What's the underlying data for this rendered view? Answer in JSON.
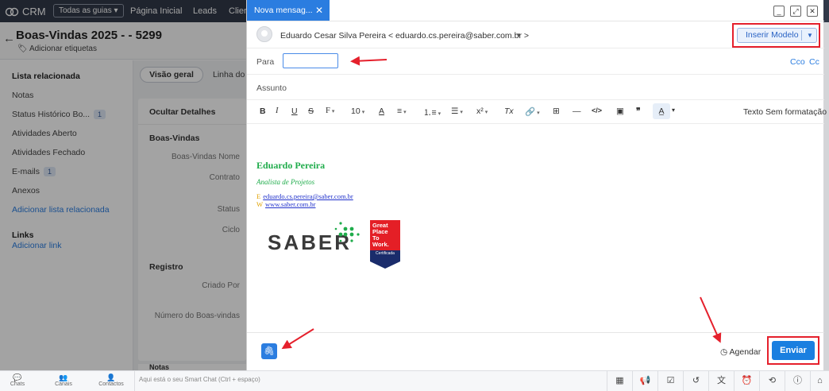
{
  "topnav": {
    "logo": "CRM",
    "all_tabs": "Todas as guias",
    "links": [
      "Página Inicial",
      "Leads",
      "Clier"
    ]
  },
  "record": {
    "title": "Boas-Vindas 2025 - - 5299",
    "add_tags": "Adicionar etiquetas"
  },
  "sidebar": {
    "section_related": "Lista relacionada",
    "items": [
      {
        "label": "Notas",
        "badge": ""
      },
      {
        "label": "Status Histórico Bo...",
        "badge": "1"
      },
      {
        "label": "Atividades Aberto",
        "badge": ""
      },
      {
        "label": "Atividades Fechado",
        "badge": ""
      },
      {
        "label": "E-mails",
        "badge": "1"
      },
      {
        "label": "Anexos",
        "badge": ""
      }
    ],
    "add_related": "Adicionar lista relacionada",
    "links_title": "Links",
    "add_link": "Adicionar link"
  },
  "detail": {
    "tab_overview": "Visão geral",
    "tab_timeline": "Linha do",
    "hide_details": "Ocultar Detalhes",
    "section1": "Boas-Vindas",
    "fields1": [
      "Boas-Vindas Nome",
      "Contrato",
      "Status",
      "Ciclo"
    ],
    "section2": "Registro",
    "fields2": [
      "Criado Por",
      "Número do Boas-vindas"
    ],
    "notes_partial": "Notas"
  },
  "compose": {
    "tab_title": "Nova mensag...",
    "from": "Eduardo Cesar Silva Pereira < eduardo.cs.pereira@saber.com.br >",
    "insert_template": "Inserir Modelo",
    "to_label": "Para",
    "cco": "Cco",
    "cc": "Cc",
    "subject_label": "Assunto",
    "toolbar": {
      "bold": "B",
      "italic": "I",
      "underline": "U",
      "strike": "S",
      "font": "F",
      "size": "10",
      "color": "A",
      "superscript": "x²",
      "clear": "Tx",
      "code": "</>",
      "quote": "❞",
      "plain_text": "Sem formatação"
    },
    "signature": {
      "name": "Eduardo Pereira",
      "role": "Analista de Projetos",
      "email_key": "E",
      "email": "eduardo.cs.pereira@saber.com.br",
      "web_key": "W",
      "web": "www.saber.com.br",
      "logo_text": "SABER",
      "badge_lines": [
        "Great",
        "Place",
        "To",
        "Work.",
        "Certificada"
      ]
    },
    "schedule": "Agendar",
    "send": "Enviar"
  },
  "bottombar": {
    "items": [
      "Chats",
      "Canais",
      "Contactos"
    ],
    "smart_chat": "Aqui está o seu Smart Chat (Ctrl + espaço)"
  },
  "colors": {
    "accent": "#2b7de0",
    "highlight_red": "#e5202c",
    "signature_green": "#1fac4b",
    "nav_bg": "#313949"
  }
}
